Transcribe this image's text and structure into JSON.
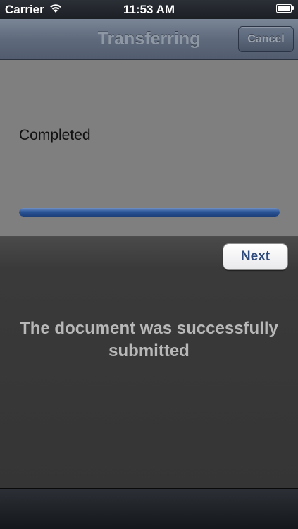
{
  "status_bar": {
    "carrier": "Carrier",
    "time": "11:53 AM",
    "icons": [
      "wifi-icon",
      "battery-icon"
    ]
  },
  "nav": {
    "title": "Transferring",
    "cancel_label": "Cancel"
  },
  "progress": {
    "status_label": "Completed",
    "fraction": 1.0,
    "color": "#2a5496"
  },
  "main": {
    "next_label": "Next",
    "message": "The document was successfully submitted"
  }
}
